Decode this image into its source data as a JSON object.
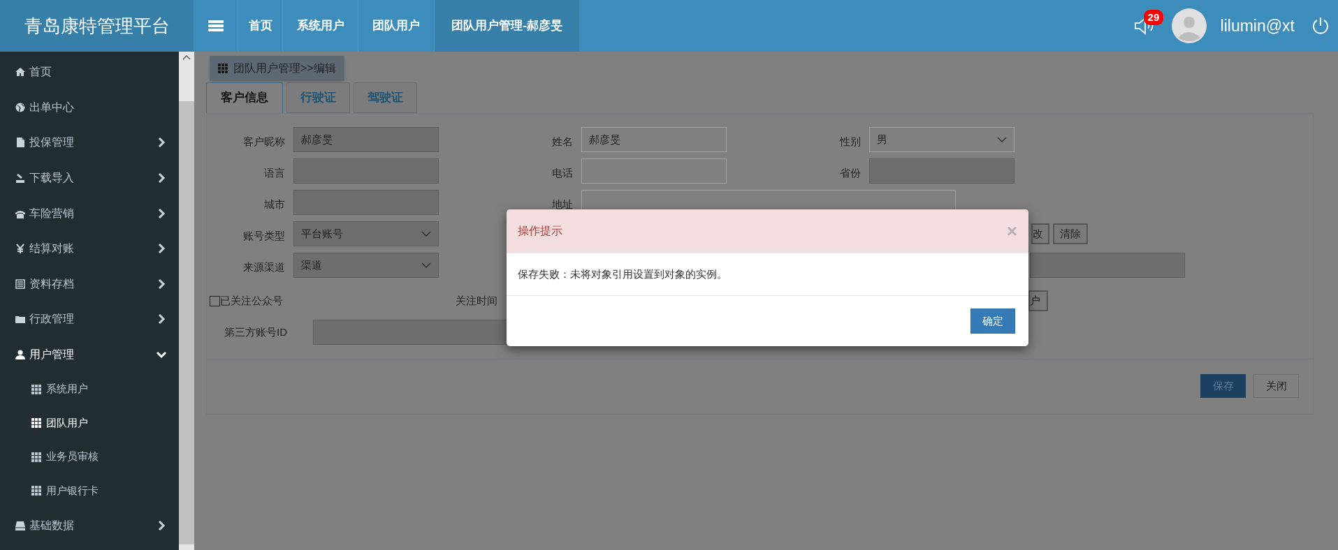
{
  "app_title": "青岛康特管理平台",
  "top_nav": [
    {
      "label": "首页",
      "selected": false
    },
    {
      "label": "系统用户",
      "selected": false
    },
    {
      "label": "团队用户",
      "selected": false
    },
    {
      "label": "团队用户管理-郝彦旻",
      "selected": true
    }
  ],
  "notifications": {
    "count": "29"
  },
  "user": {
    "name": "lilumin@xt"
  },
  "sidebar": {
    "items": [
      {
        "label": "首页"
      },
      {
        "label": "出单中心"
      },
      {
        "label": "投保管理",
        "expanded": false
      },
      {
        "label": "下载导入",
        "expanded": false
      },
      {
        "label": "车险营销",
        "expanded": false
      },
      {
        "label": "结算对账",
        "expanded": false
      },
      {
        "label": "资料存档",
        "expanded": false
      },
      {
        "label": "行政管理",
        "expanded": false
      },
      {
        "label": "用户管理",
        "expanded": true,
        "children": [
          {
            "label": "系统用户",
            "selected": false
          },
          {
            "label": "团队用户",
            "selected": true
          },
          {
            "label": "业务员审核",
            "selected": false
          },
          {
            "label": "用户银行卡",
            "selected": false
          }
        ]
      },
      {
        "label": "基础数据",
        "expanded": false
      }
    ]
  },
  "breadcrumb": "团队用户管理>>编辑",
  "tabs": [
    {
      "label": "客户信息",
      "selected": true
    },
    {
      "label": "行驶证",
      "selected": false
    },
    {
      "label": "驾驶证",
      "selected": false
    }
  ],
  "form": {
    "rows": [
      [
        {
          "kind": "field",
          "label": "客户昵称",
          "value": "郝彦旻",
          "readonly": true
        },
        {
          "kind": "field",
          "label": "姓名",
          "value": "郝彦旻",
          "readonly": false
        },
        {
          "kind": "select",
          "label": "性别",
          "value": "男",
          "readonly": false
        }
      ],
      [
        {
          "kind": "field",
          "label": "语言",
          "readonly": true
        },
        {
          "kind": "field",
          "label": "电话",
          "readonly": false
        },
        {
          "kind": "field",
          "label": "省份",
          "readonly": true
        }
      ],
      [
        {
          "kind": "field",
          "label": "城市",
          "readonly": true
        },
        {
          "kind": "wide",
          "label": "地址",
          "readonly": false
        }
      ],
      [
        {
          "kind": "select",
          "label": "账号类型",
          "value": "平台账号",
          "readonly": true
        },
        {
          "kind": "buttons",
          "labels": [
            "改",
            "清除"
          ]
        }
      ],
      [
        {
          "kind": "select",
          "label": "来源渠道",
          "value": "渠道",
          "readonly": true
        },
        {
          "kind": "bare",
          "readonly": true
        }
      ]
    ],
    "follow": {
      "label": "已关注公众号",
      "checked": false
    },
    "follow_time_label": "关注时间",
    "follow_row_button": "户",
    "third_party": {
      "label": "第三方账号ID",
      "readonly": true
    },
    "buttons": [
      {
        "label": "保存",
        "kind": "primary"
      },
      {
        "label": "关闭",
        "kind": "default"
      }
    ]
  },
  "modal": {
    "title": "操作提示",
    "close": "×",
    "message": "保存失败：未将对象引用设置到对象的实例。",
    "buttons": [
      "确定"
    ]
  }
}
